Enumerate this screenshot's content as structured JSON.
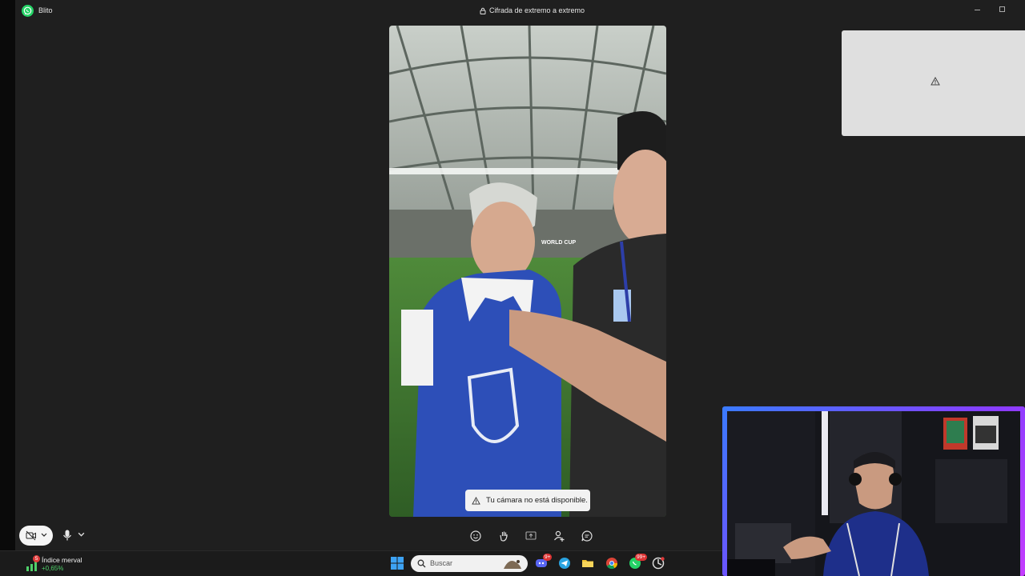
{
  "app": {
    "name": "Blito",
    "encryption_label": "Cifrada de extremo a extremo"
  },
  "main_video": {
    "banner_text": "WORLD CUP"
  },
  "self_view": {
    "status_icon": "warning-icon"
  },
  "toast": {
    "text": "Tu cámara no está disponible."
  },
  "call_controls": {
    "left": [
      "camera-off-icon",
      "mic-icon"
    ],
    "center": [
      "emoji-icon",
      "raise-hand-icon",
      "share-screen-icon",
      "add-participant-icon",
      "chat-icon"
    ]
  },
  "taskbar": {
    "widget": {
      "name": "Índice merval",
      "change": "+0,65%",
      "badge": "5"
    },
    "search_placeholder": "Buscar",
    "badges": {
      "discord": "9+",
      "whatsapp": "99+"
    }
  },
  "colors": {
    "whatsapp_green": "#25d366",
    "stock_up": "#4fd06a",
    "webcam_border_start": "#3a7bff",
    "webcam_border_end": "#c43cff"
  }
}
